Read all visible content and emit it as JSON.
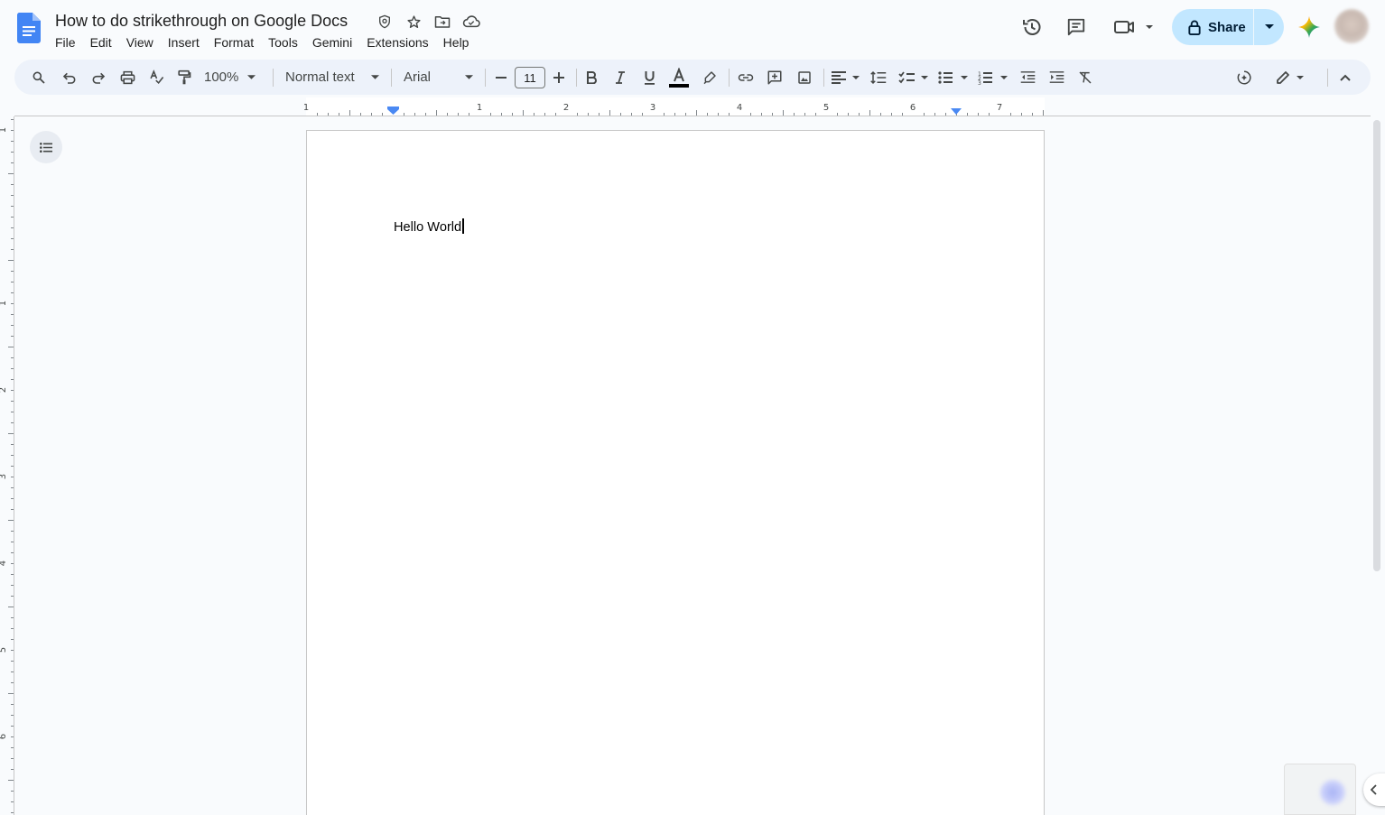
{
  "document": {
    "title": "How to do strikethrough on Google Docs",
    "body_text": "Hello World"
  },
  "menubar": {
    "items": [
      "File",
      "Edit",
      "View",
      "Insert",
      "Format",
      "Tools",
      "Gemini",
      "Extensions",
      "Help"
    ]
  },
  "header": {
    "share_label": "Share",
    "icons": [
      "docs-logo-icon",
      "shield-icon",
      "star-icon",
      "move-folder-icon",
      "cloud-status-icon",
      "version-history-icon",
      "comments-icon",
      "meet-icon",
      "lock-icon",
      "gemini-icon",
      "avatar"
    ]
  },
  "toolbar": {
    "zoom": "100%",
    "style": "Normal text",
    "font": "Arial",
    "font_size": "11",
    "icons": [
      "search-icon",
      "undo-icon",
      "redo-icon",
      "print-icon",
      "spellcheck-icon",
      "paint-format-icon",
      "decrease-font-icon",
      "increase-font-icon",
      "bold-icon",
      "italic-icon",
      "underline-icon",
      "text-color-icon",
      "highlight-icon",
      "link-icon",
      "add-comment-icon",
      "insert-image-icon",
      "align-icon",
      "line-spacing-icon",
      "checklist-icon",
      "bulleted-list-icon",
      "numbered-list-icon",
      "decrease-indent-icon",
      "increase-indent-icon",
      "clear-formatting-icon",
      "gemini-refine-icon",
      "editing-mode-icon",
      "collapse-menu-icon"
    ]
  },
  "ruler": {
    "top_labels": [
      "1",
      "1",
      "2",
      "3",
      "4",
      "5",
      "6",
      "7"
    ],
    "left_labels": [
      "1",
      "1",
      "2",
      "3",
      "4",
      "5",
      "6"
    ]
  },
  "colors": {
    "accent": "#0b57d0",
    "share_bg": "#c2e7ff",
    "toolbar_bg": "#edf2fa",
    "page_bg": "#f9fbfd"
  }
}
